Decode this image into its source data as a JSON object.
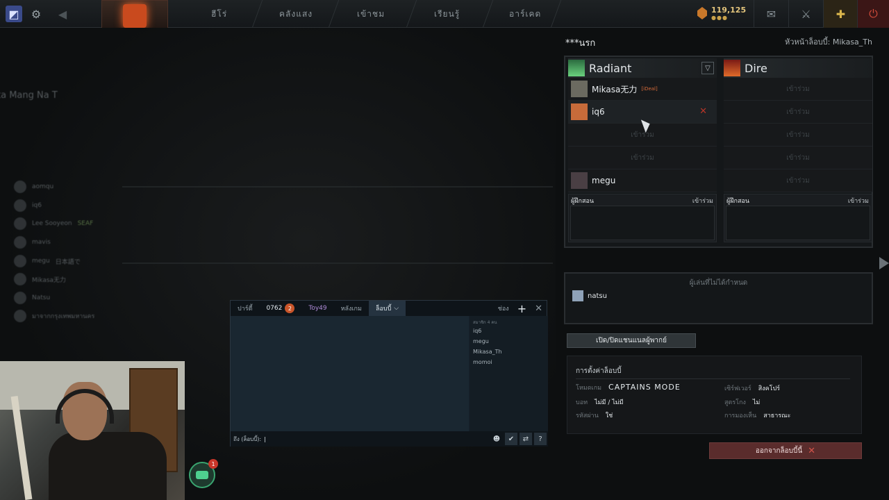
{
  "topbar": {
    "nav": [
      "ฮีโร่",
      "คลังแสง",
      "เข้าชม",
      "เรียนรู้",
      "อาร์เคด"
    ],
    "shards": "119,125",
    "shards_dots": "●●●"
  },
  "background": {
    "friends": [
      "aomqu",
      "iq6",
      "Lee Sooyeon",
      "mavis",
      "megu",
      "Mikasa无力",
      "Natsu",
      "มาจากกรุงเทพมหานคร"
    ],
    "side_labels": [
      "SEAF",
      "日本語で"
    ],
    "heading": "ta Mang Na T"
  },
  "chat": {
    "tabs": [
      {
        "label": "ปาร์ตี้"
      },
      {
        "label": "0762",
        "count": "2"
      },
      {
        "label": "Toy49"
      },
      {
        "label": "หลังเกม"
      },
      {
        "label": "ล็อบบี้"
      }
    ],
    "channel_label": "ช่อง",
    "members_header": "สมาชิก 4 คน",
    "members": [
      "iq6",
      "megu",
      "Mikasa_Th",
      "momoi"
    ],
    "input_prefix": "ถึง (ล็อบบี้):"
  },
  "social": {
    "badge": "1"
  },
  "lobby": {
    "name": "***นรก",
    "leader": "หัวหน้าล็อบบี้: Mikasa_Th",
    "radiant": {
      "name": "Radiant",
      "slots": [
        {
          "player": "Mikasa无力",
          "tag": "[iDeal]"
        },
        {
          "player": "iq6",
          "tag": ""
        },
        {
          "player": "",
          "join": "เข้าร่วม"
        },
        {
          "player": "",
          "join": "เข้าร่วม"
        },
        {
          "player": "megu",
          "tag": ""
        }
      ],
      "coach_label": "ผู้ฝึกสอน",
      "coach_join": "เข้าร่วม"
    },
    "dire": {
      "name": "Dire",
      "slots": [
        {
          "join": "เข้าร่วม"
        },
        {
          "join": "เข้าร่วม"
        },
        {
          "join": "เข้าร่วม"
        },
        {
          "join": "เข้าร่วม"
        },
        {
          "join": "เข้าร่วม"
        }
      ],
      "coach_label": "ผู้ฝึกสอน",
      "coach_join": "เข้าร่วม"
    },
    "unassigned_title": "ผู้เล่นที่ไม่ได้กำหนด",
    "unassigned": [
      "natsu"
    ],
    "toggle_caster": "เปิด/ปิดแชนแนลผู้พากย์",
    "settings": {
      "title": "การตั้งค่าล็อบบี้",
      "game_mode_label": "โหมดเกม",
      "game_mode": "CAPTAINS MODE",
      "server_label": "เซิร์ฟเวอร์",
      "server": "สิงคโปร์",
      "bots_label": "บอท",
      "bots": "ไม่มี / ไม่มี",
      "cheats_label": "สูตรโกง",
      "cheats": "ไม่",
      "password_label": "รหัสผ่าน",
      "password": "ใช่",
      "visibility_label": "การมองเห็น",
      "visibility": "สาธารณะ"
    },
    "leave": "ออกจากล็อบบี้นี้"
  }
}
